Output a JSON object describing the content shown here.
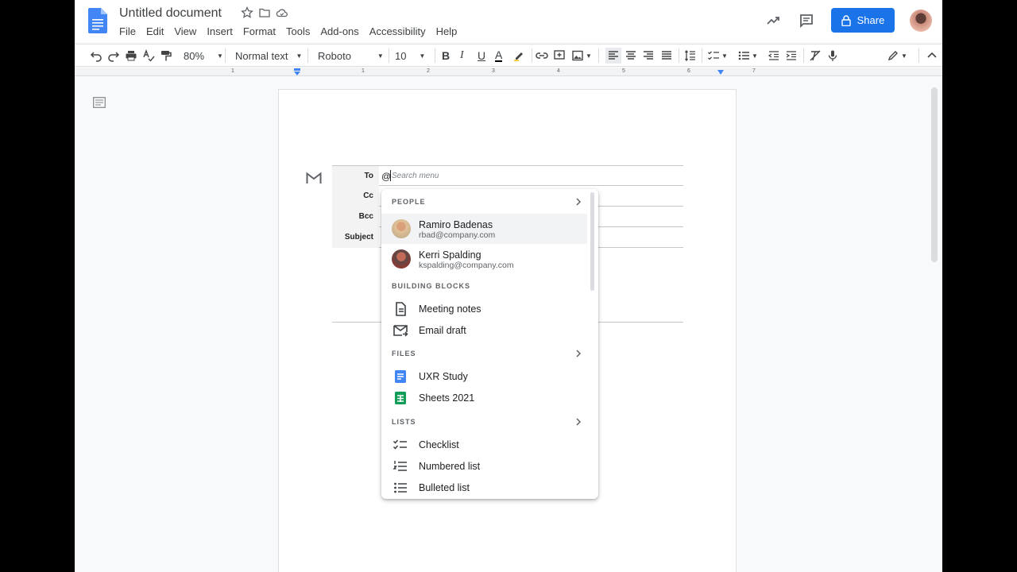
{
  "doc": {
    "title": "Untitled document",
    "menus": [
      "File",
      "Edit",
      "View",
      "Insert",
      "Format",
      "Tools",
      "Add-ons",
      "Accessibility",
      "Help"
    ],
    "share_label": "Share"
  },
  "toolbar": {
    "zoom": "80%",
    "style": "Normal text",
    "font": "Roboto",
    "size": "10"
  },
  "ruler": [
    "1",
    "1",
    "2",
    "3",
    "4",
    "5",
    "6",
    "7"
  ],
  "email": {
    "labels": [
      "To",
      "Cc",
      "Bcc",
      "Subject"
    ],
    "to_value": "@",
    "search_placeholder": "Search menu"
  },
  "menu": {
    "sections": {
      "people": "PEOPLE",
      "building_blocks": "BUILDING BLOCKS",
      "files": "FILES",
      "lists": "LISTS"
    },
    "people": [
      {
        "name": "Ramiro Badenas",
        "email": "rbad@company.com"
      },
      {
        "name": "Kerri Spalding",
        "email": "kspalding@company.com"
      }
    ],
    "blocks": [
      "Meeting notes",
      "Email draft"
    ],
    "files": [
      "UXR Study",
      "Sheets 2021"
    ],
    "lists": [
      "Checklist",
      "Numbered list",
      "Bulleted list"
    ]
  },
  "colors": {
    "accent": "#1a73e8",
    "docs_blue": "#4285f4",
    "sheets_green": "#0f9d58",
    "hover": "#f1f3f4"
  }
}
